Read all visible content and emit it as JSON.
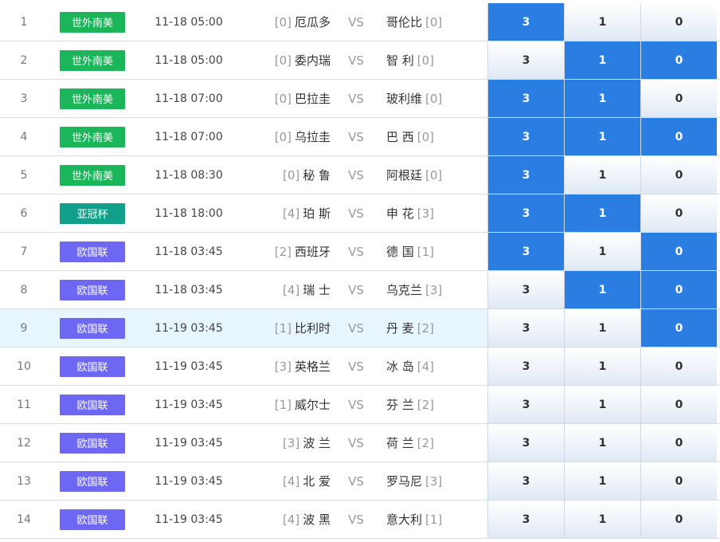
{
  "colors": {
    "league_南美": "#1cb65a",
    "league_亚冠": "#13a08a",
    "league_欧国联": "#6d67f4",
    "selected": "#2a7ee2",
    "highlight_row": "#e6f6fc"
  },
  "matches": [
    {
      "num": "1",
      "league": "世外南美",
      "league_key": "南美",
      "time": "11-18 05:00",
      "home_rank": "[0]",
      "home": "厄瓜多",
      "vs": "VS",
      "away": "哥伦比",
      "away_rank": "[0]",
      "opts": [
        "3",
        "1",
        "0"
      ],
      "sel": [
        true,
        false,
        false
      ]
    },
    {
      "num": "2",
      "league": "世外南美",
      "league_key": "南美",
      "time": "11-18 05:00",
      "home_rank": "[0]",
      "home": "委内瑞",
      "vs": "VS",
      "away": "智 利",
      "away_rank": "[0]",
      "opts": [
        "3",
        "1",
        "0"
      ],
      "sel": [
        false,
        true,
        true
      ]
    },
    {
      "num": "3",
      "league": "世外南美",
      "league_key": "南美",
      "time": "11-18 07:00",
      "home_rank": "[0]",
      "home": "巴拉圭",
      "vs": "VS",
      "away": "玻利维",
      "away_rank": "[0]",
      "opts": [
        "3",
        "1",
        "0"
      ],
      "sel": [
        true,
        true,
        false
      ]
    },
    {
      "num": "4",
      "league": "世外南美",
      "league_key": "南美",
      "time": "11-18 07:00",
      "home_rank": "[0]",
      "home": "乌拉圭",
      "vs": "VS",
      "away": "巴 西",
      "away_rank": "[0]",
      "opts": [
        "3",
        "1",
        "0"
      ],
      "sel": [
        true,
        true,
        true
      ]
    },
    {
      "num": "5",
      "league": "世外南美",
      "league_key": "南美",
      "time": "11-18 08:30",
      "home_rank": "[0]",
      "home": "秘 鲁",
      "vs": "VS",
      "away": "阿根廷",
      "away_rank": "[0]",
      "opts": [
        "3",
        "1",
        "0"
      ],
      "sel": [
        true,
        false,
        false
      ]
    },
    {
      "num": "6",
      "league": "亚冠杯",
      "league_key": "亚冠",
      "time": "11-18 18:00",
      "home_rank": "[4]",
      "home": "珀 斯",
      "vs": "VS",
      "away": "申 花",
      "away_rank": "[3]",
      "opts": [
        "3",
        "1",
        "0"
      ],
      "sel": [
        true,
        true,
        false
      ]
    },
    {
      "num": "7",
      "league": "欧国联",
      "league_key": "欧国联",
      "time": "11-18 03:45",
      "home_rank": "[2]",
      "home": "西班牙",
      "vs": "VS",
      "away": "德 国",
      "away_rank": "[1]",
      "opts": [
        "3",
        "1",
        "0"
      ],
      "sel": [
        true,
        false,
        true
      ]
    },
    {
      "num": "8",
      "league": "欧国联",
      "league_key": "欧国联",
      "time": "11-18 03:45",
      "home_rank": "[4]",
      "home": "瑞 士",
      "vs": "VS",
      "away": "乌克兰",
      "away_rank": "[3]",
      "opts": [
        "3",
        "1",
        "0"
      ],
      "sel": [
        false,
        true,
        true
      ]
    },
    {
      "num": "9",
      "league": "欧国联",
      "league_key": "欧国联",
      "time": "11-19 03:45",
      "home_rank": "[1]",
      "home": "比利时",
      "vs": "VS",
      "away": "丹 麦",
      "away_rank": "[2]",
      "opts": [
        "3",
        "1",
        "0"
      ],
      "sel": [
        false,
        false,
        true
      ],
      "highlight": true
    },
    {
      "num": "10",
      "league": "欧国联",
      "league_key": "欧国联",
      "time": "11-19 03:45",
      "home_rank": "[3]",
      "home": "英格兰",
      "vs": "VS",
      "away": "冰 岛",
      "away_rank": "[4]",
      "opts": [
        "3",
        "1",
        "0"
      ],
      "sel": [
        false,
        false,
        false
      ]
    },
    {
      "num": "11",
      "league": "欧国联",
      "league_key": "欧国联",
      "time": "11-19 03:45",
      "home_rank": "[1]",
      "home": "威尔士",
      "vs": "VS",
      "away": "芬 兰",
      "away_rank": "[2]",
      "opts": [
        "3",
        "1",
        "0"
      ],
      "sel": [
        false,
        false,
        false
      ]
    },
    {
      "num": "12",
      "league": "欧国联",
      "league_key": "欧国联",
      "time": "11-19 03:45",
      "home_rank": "[3]",
      "home": "波 兰",
      "vs": "VS",
      "away": "荷 兰",
      "away_rank": "[2]",
      "opts": [
        "3",
        "1",
        "0"
      ],
      "sel": [
        false,
        false,
        false
      ]
    },
    {
      "num": "13",
      "league": "欧国联",
      "league_key": "欧国联",
      "time": "11-19 03:45",
      "home_rank": "[4]",
      "home": "北 爱",
      "vs": "VS",
      "away": "罗马尼",
      "away_rank": "[3]",
      "opts": [
        "3",
        "1",
        "0"
      ],
      "sel": [
        false,
        false,
        false
      ]
    },
    {
      "num": "14",
      "league": "欧国联",
      "league_key": "欧国联",
      "time": "11-19 03:45",
      "home_rank": "[4]",
      "home": "波 黑",
      "vs": "VS",
      "away": "意大利",
      "away_rank": "[1]",
      "opts": [
        "3",
        "1",
        "0"
      ],
      "sel": [
        false,
        false,
        false
      ]
    }
  ]
}
